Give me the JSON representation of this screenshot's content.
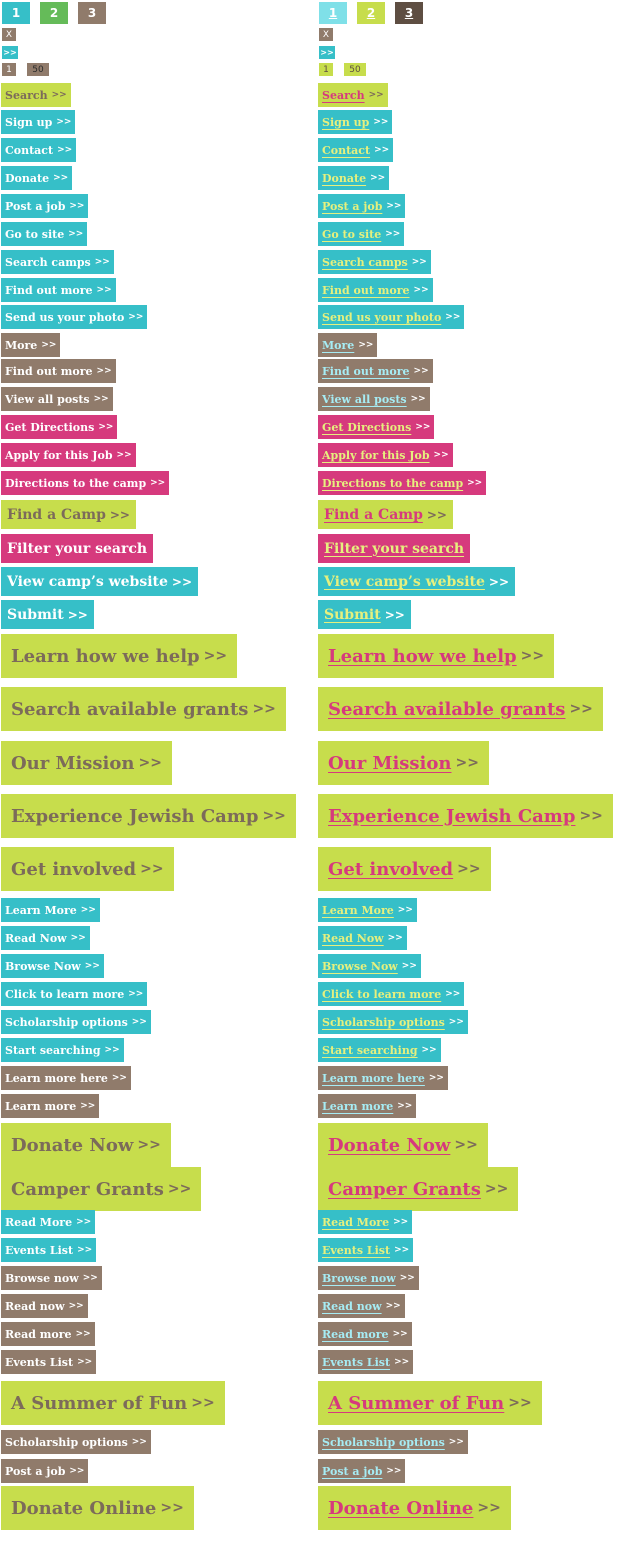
{
  "columns": [
    "default",
    "hover"
  ],
  "pagination": [
    "1",
    "2",
    "3"
  ],
  "close_label": "X",
  "next_label": ">>",
  "page_range": [
    "1",
    "50"
  ],
  "arrow": ">>",
  "buttons": [
    {
      "label": "Search",
      "color": "lime",
      "size": "s"
    },
    {
      "label": "Sign up",
      "color": "teal",
      "size": "s"
    },
    {
      "label": "Contact",
      "color": "teal",
      "size": "s"
    },
    {
      "label": "Donate",
      "color": "teal",
      "size": "s"
    },
    {
      "label": "Post a job",
      "color": "teal",
      "size": "s"
    },
    {
      "label": "Go to site",
      "color": "teal",
      "size": "s"
    },
    {
      "label": "Search camps",
      "color": "teal",
      "size": "s"
    },
    {
      "label": "Find out more",
      "color": "teal",
      "size": "s"
    },
    {
      "label": "Send us your photo",
      "color": "teal",
      "size": "s"
    },
    {
      "label": "More",
      "color": "brown",
      "size": "s"
    },
    {
      "label": "Find out more",
      "color": "brown",
      "size": "s"
    },
    {
      "label": "View all posts",
      "color": "brown",
      "size": "s"
    },
    {
      "label": "Get Directions",
      "color": "pink",
      "size": "s"
    },
    {
      "label": "Apply for this Job",
      "color": "pink",
      "size": "s"
    },
    {
      "label": "Directions to the camp",
      "color": "pink",
      "size": "s"
    },
    {
      "label": "Find a Camp",
      "color": "lime",
      "size": "m"
    },
    {
      "label": "Filter your search",
      "color": "pink",
      "size": "m",
      "no_arrow": true
    },
    {
      "label": "View camp’s website",
      "color": "teal",
      "size": "m"
    },
    {
      "label": "Submit",
      "color": "teal",
      "size": "m"
    },
    {
      "label": "Learn how we help",
      "color": "lime",
      "size": "l"
    },
    {
      "label": "Search available grants",
      "color": "lime",
      "size": "l"
    },
    {
      "label": "Our Mission",
      "color": "lime",
      "size": "l"
    },
    {
      "label": "Experience Jewish Camp",
      "color": "lime",
      "size": "l"
    },
    {
      "label": "Get involved",
      "color": "lime",
      "size": "l"
    },
    {
      "label": "Learn More",
      "color": "teal",
      "size": "s"
    },
    {
      "label": "Read Now",
      "color": "teal",
      "size": "s"
    },
    {
      "label": "Browse Now",
      "color": "teal",
      "size": "s"
    },
    {
      "label": "Click to learn more",
      "color": "teal",
      "size": "s"
    },
    {
      "label": "Scholarship options",
      "color": "teal",
      "size": "s"
    },
    {
      "label": "Start searching",
      "color": "teal",
      "size": "s"
    },
    {
      "label": "Learn more here",
      "color": "brown",
      "size": "s"
    },
    {
      "label": "Learn more",
      "color": "brown",
      "size": "s"
    },
    {
      "label": "Donate Now",
      "color": "lime",
      "size": "l"
    },
    {
      "label": "Camper Grants",
      "color": "lime",
      "size": "l"
    },
    {
      "label": "Read More",
      "color": "teal",
      "size": "s"
    },
    {
      "label": "Events List",
      "color": "teal",
      "size": "s"
    },
    {
      "label": "Browse now",
      "color": "brown",
      "size": "s"
    },
    {
      "label": "Read now",
      "color": "brown",
      "size": "s"
    },
    {
      "label": "Read more",
      "color": "brown",
      "size": "s"
    },
    {
      "label": "Events List",
      "color": "brown",
      "size": "s"
    },
    {
      "label": "A Summer of Fun",
      "color": "lime",
      "size": "l"
    },
    {
      "label": "Scholarship options",
      "color": "brown",
      "size": "s"
    },
    {
      "label": "Post a job",
      "color": "brown",
      "size": "s"
    },
    {
      "label": "Donate Online",
      "color": "lime",
      "size": "l"
    }
  ]
}
